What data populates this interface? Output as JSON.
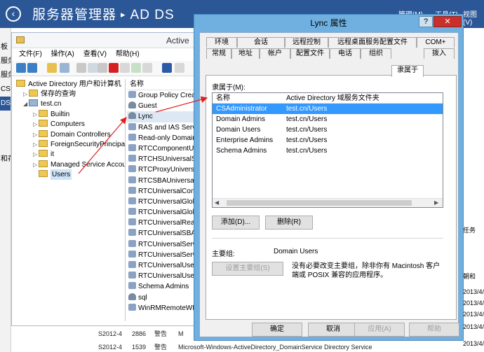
{
  "server_manager": {
    "title": "服务器管理器",
    "separator": "▸",
    "page": "AD DS",
    "menus": [
      "管理(M)",
      "工具(T)",
      "视图(V)"
    ],
    "nav_items": [
      "板",
      "服务",
      "服务",
      "CS",
      "DS",
      "",
      "",
      "",
      "和存"
    ],
    "right_items": [
      "任务",
      "朝和",
      "2013/4/",
      "2013/4/",
      "2013/4/",
      "2013/4/",
      "2013/4/"
    ],
    "bottom_rows": [
      {
        "server": "S2012-4",
        "id": "2886",
        "level": "警告",
        "source": "M"
      },
      {
        "server": "S2012-4",
        "id": "1539",
        "level": "警告",
        "source": "Microsoft-Windows-ActiveDirectory_DomainService  Directory Service"
      }
    ]
  },
  "aduc": {
    "title": "Active",
    "menus": [
      "文件(F)",
      "操作(A)",
      "查看(V)",
      "帮助(H)"
    ],
    "tree": [
      {
        "label": "Active Directory 用户和计算机",
        "level": 0,
        "arrow": ""
      },
      {
        "label": "保存的查询",
        "level": 1,
        "arrow": "▷"
      },
      {
        "label": "test.cn",
        "level": 1,
        "arrow": "◢"
      },
      {
        "label": "Builtin",
        "level": 2,
        "arrow": "▷"
      },
      {
        "label": "Computers",
        "level": 2,
        "arrow": "▷"
      },
      {
        "label": "Domain Controllers",
        "level": 2,
        "arrow": "▷"
      },
      {
        "label": "ForeignSecurityPrincipals",
        "level": 2,
        "arrow": "▷"
      },
      {
        "label": "it",
        "level": 2,
        "arrow": "▷"
      },
      {
        "label": "Managed Service Accounts",
        "level": 2,
        "arrow": "▷"
      },
      {
        "label": "Users",
        "level": 2,
        "arrow": ""
      }
    ],
    "list_header": "名称",
    "list_items": [
      {
        "label": "Group Policy Creator Owners",
        "kind": "group"
      },
      {
        "label": "Guest",
        "kind": "user"
      },
      {
        "label": "Lync",
        "kind": "user"
      },
      {
        "label": "RAS and IAS Servers",
        "kind": "group"
      },
      {
        "label": "Read-only Domain Controllers",
        "kind": "group"
      },
      {
        "label": "RTCComponentUniversalServices",
        "kind": "group"
      },
      {
        "label": "RTCHSUniversalServices",
        "kind": "group"
      },
      {
        "label": "RTCProxyUniversalServices",
        "kind": "group"
      },
      {
        "label": "RTCSBAUniversalServices",
        "kind": "group"
      },
      {
        "label": "RTCUniversalConfigReplicator",
        "kind": "group"
      },
      {
        "label": "RTCUniversalGlobalReadOnlyGroup",
        "kind": "group"
      },
      {
        "label": "RTCUniversalGlobalWriteGroup",
        "kind": "group"
      },
      {
        "label": "RTCUniversalReadOnlyAdmins",
        "kind": "group"
      },
      {
        "label": "RTCUniversalSBATechnicians",
        "kind": "group"
      },
      {
        "label": "RTCUniversalServerAdmins",
        "kind": "group"
      },
      {
        "label": "RTCUniversalServerReadOnlyGroup",
        "kind": "group"
      },
      {
        "label": "RTCUniversalUserAdmins",
        "kind": "group"
      },
      {
        "label": "RTCUniversalUserReadOnlyGroup",
        "kind": "group"
      },
      {
        "label": "Schema Admins",
        "kind": "group"
      },
      {
        "label": "sql",
        "kind": "user"
      },
      {
        "label": "WinRMRemoteWMIUsers__",
        "kind": "group"
      }
    ]
  },
  "dialog": {
    "title": "Lync 属性",
    "help_label": "?",
    "close_label": "✕",
    "tabs_row1": [
      "环境",
      "会话",
      "远程控制",
      "远程桌面服务配置文件",
      "COM+"
    ],
    "tabs_row2": [
      "常规",
      "地址",
      "帐户",
      "配置文件",
      "电话",
      "组织",
      "隶属于",
      "拨入"
    ],
    "member_of_label": "隶属于(M):",
    "columns": [
      "名称",
      "Active Directory 域服务文件夹"
    ],
    "rows": [
      {
        "name": "CSAdministrator",
        "folder": "test.cn/Users"
      },
      {
        "name": "Domain Admins",
        "folder": "test.cn/Users"
      },
      {
        "name": "Domain Users",
        "folder": "test.cn/Users"
      },
      {
        "name": "Enterprise Admins",
        "folder": "test.cn/Users"
      },
      {
        "name": "Schema Admins",
        "folder": "test.cn/Users"
      }
    ],
    "add_label": "添加(D)...",
    "remove_label": "删除(R)",
    "primary_group_label": "主要组:",
    "primary_group_value": "Domain Users",
    "set_primary_label": "设置主要组(S)",
    "note": "没有必要改变主要组，除非你有 Macintosh 客户端或 POSIX 兼容的应用程序。",
    "ok_label": "确定",
    "cancel_label": "取消",
    "apply_label": "应用(A)",
    "help_button_label": "帮助"
  }
}
